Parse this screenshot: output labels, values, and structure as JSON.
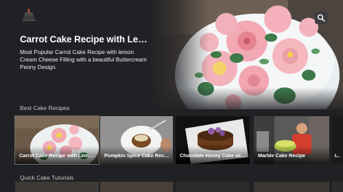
{
  "app": {
    "logo_icon": "cake-logo-icon"
  },
  "search": {
    "icon": "search-icon"
  },
  "hero": {
    "title": "Carrot Cake Recipe with Lemo...",
    "description": "Most Popular Carrot Cake Recipe with lemon Cream Cheese Filling with a beautiful Buttercream Peony Design."
  },
  "rows": [
    {
      "title": "Best Cake Recipes",
      "cards": [
        {
          "label": "Carrot Cake Recipe with Lemon..."
        },
        {
          "label": "Pumpkin Spice Cake Recipe"
        },
        {
          "label": "Chocolate Honey Cake with..."
        },
        {
          "label": "Marble Cake Recipe"
        },
        {
          "label": "Lus"
        }
      ]
    },
    {
      "title": "Quick Cake Tutorials"
    }
  ]
}
